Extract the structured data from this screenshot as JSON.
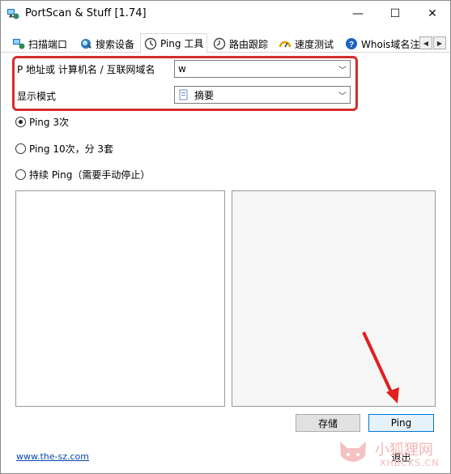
{
  "window": {
    "title": "PortScan & Stuff [1.74]",
    "minimize": "—",
    "maximize": "☐",
    "close": "✕"
  },
  "tabs": [
    {
      "label": "扫描端口",
      "icon": "network-scan-icon",
      "active": false
    },
    {
      "label": "搜索设备",
      "icon": "search-device-icon",
      "active": false
    },
    {
      "label": "Ping 工具",
      "icon": "ping-clock-icon",
      "active": true
    },
    {
      "label": "路由跟踪",
      "icon": "traceroute-clock-icon",
      "active": false
    },
    {
      "label": "速度测试",
      "icon": "speedometer-icon",
      "active": false
    },
    {
      "label": "Whois域名注",
      "icon": "help-circle-icon",
      "active": false
    }
  ],
  "form": {
    "host_label": "P 地址或 计算机名 / 互联网域名",
    "host_value": "w",
    "mode_label": "显示模式",
    "mode_value": "摘要"
  },
  "options": [
    {
      "label": "Ping 3次",
      "checked": true
    },
    {
      "label": "Ping 10次，分 3套",
      "checked": false
    },
    {
      "label": "持续 Ping（需要手动停止）",
      "checked": false
    }
  ],
  "buttons": {
    "save": "存储",
    "ping": "Ping",
    "exit": "退出"
  },
  "footer": {
    "link": "www.the-sz.com"
  },
  "watermark": {
    "text": "小狐狸网",
    "subtext": "XHBCKS.CN"
  },
  "colors": {
    "highlight_box": "#d42d2d",
    "annotation_arrow": "#e02020",
    "link": "#0645ad",
    "primary_button_border": "#0078d7"
  }
}
